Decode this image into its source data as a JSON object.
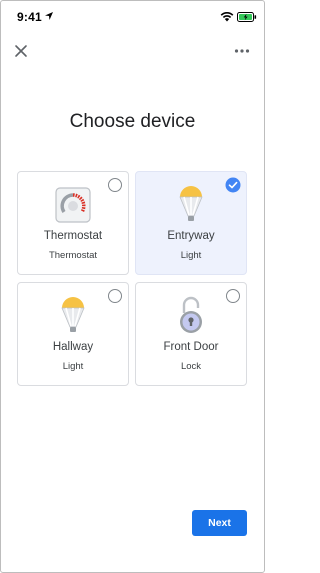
{
  "status_bar": {
    "time": "9:41",
    "battery_color": "#34c759"
  },
  "header": {
    "close_icon": "close-icon",
    "more_icon": "more-horizontal-icon"
  },
  "title": "Choose device",
  "devices": [
    {
      "name": "Thermostat",
      "type": "Thermostat",
      "icon": "thermostat-icon",
      "selected": false
    },
    {
      "name": "Entryway",
      "type": "Light",
      "icon": "light-bulb-icon",
      "selected": true
    },
    {
      "name": "Hallway",
      "type": "Light",
      "icon": "light-bulb-icon",
      "selected": false
    },
    {
      "name": "Front Door",
      "type": "Lock",
      "icon": "padlock-icon",
      "selected": false
    }
  ],
  "footer": {
    "next_label": "Next"
  },
  "colors": {
    "accent": "#1a73e8",
    "selected_bg": "#eef2fd",
    "bulb_yellow": "#f6c244",
    "thermostat_red": "#d93025"
  }
}
